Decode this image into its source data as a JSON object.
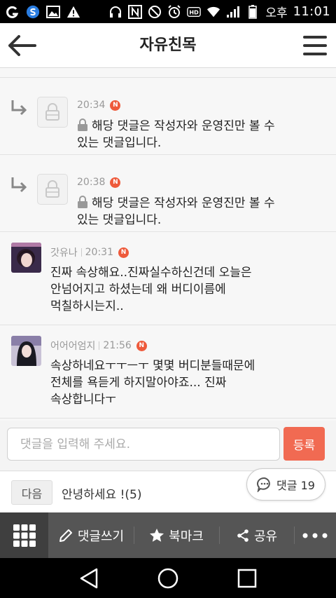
{
  "status_bar": {
    "ampm": "오후",
    "time": "11:01",
    "icons": [
      "g-app-icon",
      "s-app-icon",
      "image-icon",
      "warning-icon",
      "headset-icon",
      "nfc-icon",
      "do-not-disturb-icon",
      "alarm-icon",
      "hd-icon",
      "wifi-icon",
      "signal-icon",
      "battery-icon"
    ]
  },
  "header": {
    "title": "자유친목",
    "back_icon": "back-arrow-icon",
    "menu_icon": "hamburger-menu-icon"
  },
  "comments": [
    {
      "type": "reply-secret",
      "time": "20:34",
      "badge": "N",
      "text_line1": "해당 댓글은 작성자와 운영진만 볼 수",
      "text_line2": "있는 댓글입니다."
    },
    {
      "type": "reply-secret",
      "time": "20:38",
      "badge": "N",
      "text_line1": "해당 댓글은 작성자와 운영진만 볼 수",
      "text_line2": "있는 댓글입니다."
    },
    {
      "type": "normal",
      "author": "갓유나",
      "time": "20:31",
      "badge": "N",
      "text_line1": "진짜 속상해요..진짜실수하신건데 오늘은",
      "text_line2": "안넘어지고 하셨는데 왜 버디이름에",
      "text_line3": "먹칠하시는지.."
    },
    {
      "type": "normal",
      "author": "어어어엄지",
      "time": "21:56",
      "badge": "N",
      "text_line1": "속상하네요ㅜㅜㅡㅜ 몇몇 버디분들때문에",
      "text_line2": "전체를 욕듣게 하지말아야죠... 진짜",
      "text_line3": "속상합니다ㅜ"
    }
  ],
  "comment_input": {
    "placeholder": "댓글을 입력해 주세요.",
    "value": "",
    "submit_label": "등록"
  },
  "next_post": {
    "badge": "다음",
    "title": "안녕하세요 !(5)"
  },
  "comment_count": {
    "label": "댓글 19"
  },
  "toolbar": {
    "write_label": "댓글쓰기",
    "bookmark_label": "북마크",
    "share_label": "공유"
  },
  "colors": {
    "accent": "#f16a52",
    "new_badge": "#ee5a3b",
    "toolbar_bg": "#555555"
  }
}
